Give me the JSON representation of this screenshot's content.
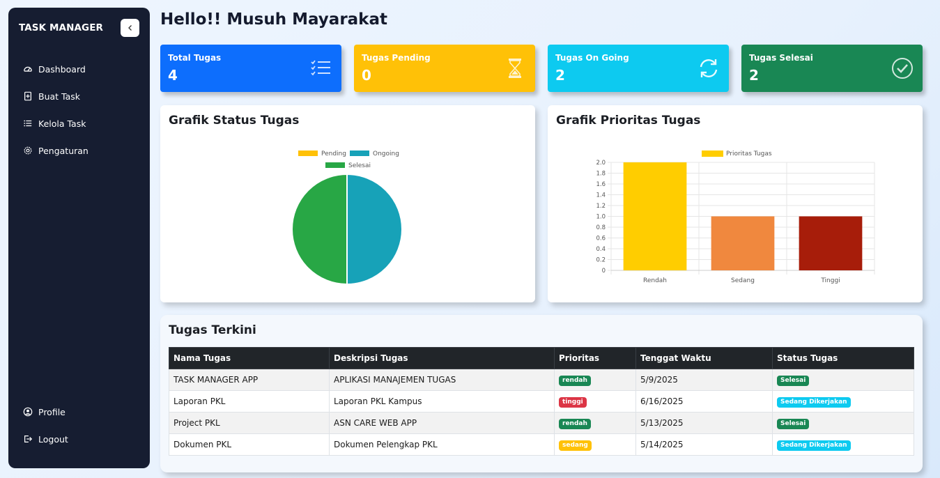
{
  "sidebar": {
    "brand": "TASK MANAGER",
    "items": [
      {
        "label": "Dashboard",
        "icon": "speedometer-icon"
      },
      {
        "label": "Buat Task",
        "icon": "add-file-icon"
      },
      {
        "label": "Kelola Task",
        "icon": "list-icon"
      },
      {
        "label": "Pengaturan",
        "icon": "gear-icon"
      }
    ],
    "bottom_items": [
      {
        "label": "Profile",
        "icon": "user-circle-icon"
      },
      {
        "label": "Logout",
        "icon": "logout-icon"
      }
    ]
  },
  "header": {
    "title": "Hello!! Musuh Mayarakat"
  },
  "stats": [
    {
      "label": "Total Tugas",
      "value": "4",
      "color": "#0d6efd",
      "icon": "checklist-icon"
    },
    {
      "label": "Tugas Pending",
      "value": "0",
      "color": "#ffc107",
      "icon": "hourglass-icon"
    },
    {
      "label": "Tugas On Going",
      "value": "2",
      "color": "#0dcaf0",
      "icon": "refresh-icon"
    },
    {
      "label": "Tugas Selesai",
      "value": "2",
      "color": "#198754",
      "icon": "check-circle-icon"
    }
  ],
  "status_chart_panel": {
    "title": "Grafik Status Tugas"
  },
  "priority_chart_panel": {
    "title": "Grafik Prioritas Tugas"
  },
  "chart_data": [
    {
      "type": "pie",
      "categories": [
        "Pending",
        "Ongoing",
        "Selesai"
      ],
      "values": [
        0,
        2,
        2
      ],
      "colors": [
        "#ffc107",
        "#17a2b8",
        "#28a745"
      ],
      "legend": "top"
    },
    {
      "type": "bar",
      "categories": [
        "Rendah",
        "Sedang",
        "Tinggi"
      ],
      "series": [
        {
          "name": "Prioritas Tugas",
          "values": [
            2,
            1,
            1
          ]
        }
      ],
      "colors": [
        "#ffcd00",
        "#f0883e",
        "#a71d0a"
      ],
      "ylim": [
        0,
        2.0
      ],
      "yticks": [
        "2.0",
        "1.8",
        "1.6",
        "1.4",
        "1.2",
        "1.0",
        "0.8",
        "0.6",
        "0.4",
        "0.2",
        "0"
      ],
      "grid": true,
      "legend": "top"
    }
  ],
  "recent": {
    "title": "Tugas Terkini",
    "headers": [
      "Nama Tugas",
      "Deskripsi Tugas",
      "Prioritas",
      "Tenggat Waktu",
      "Status Tugas"
    ],
    "rows": [
      {
        "name": "TASK MANAGER APP",
        "desc": "APLIKASI MANAJEMEN TUGAS",
        "priority": "rendah",
        "priority_color": "#198754",
        "deadline": "5/9/2025",
        "status": "Selesai",
        "status_color": "#198754"
      },
      {
        "name": "Laporan PKL",
        "desc": "Laporan PKL Kampus",
        "priority": "tinggi",
        "priority_color": "#dc3545",
        "deadline": "6/16/2025",
        "status": "Sedang Dikerjakan",
        "status_color": "#0dcaf0"
      },
      {
        "name": "Project PKL",
        "desc": "ASN CARE WEB APP",
        "priority": "rendah",
        "priority_color": "#198754",
        "deadline": "5/13/2025",
        "status": "Selesai",
        "status_color": "#198754"
      },
      {
        "name": "Dokumen PKL",
        "desc": "Dokumen Pelengkap PKL",
        "priority": "sedang",
        "priority_color": "#ffc107",
        "deadline": "5/14/2025",
        "status": "Sedang Dikerjakan",
        "status_color": "#0dcaf0"
      }
    ]
  }
}
